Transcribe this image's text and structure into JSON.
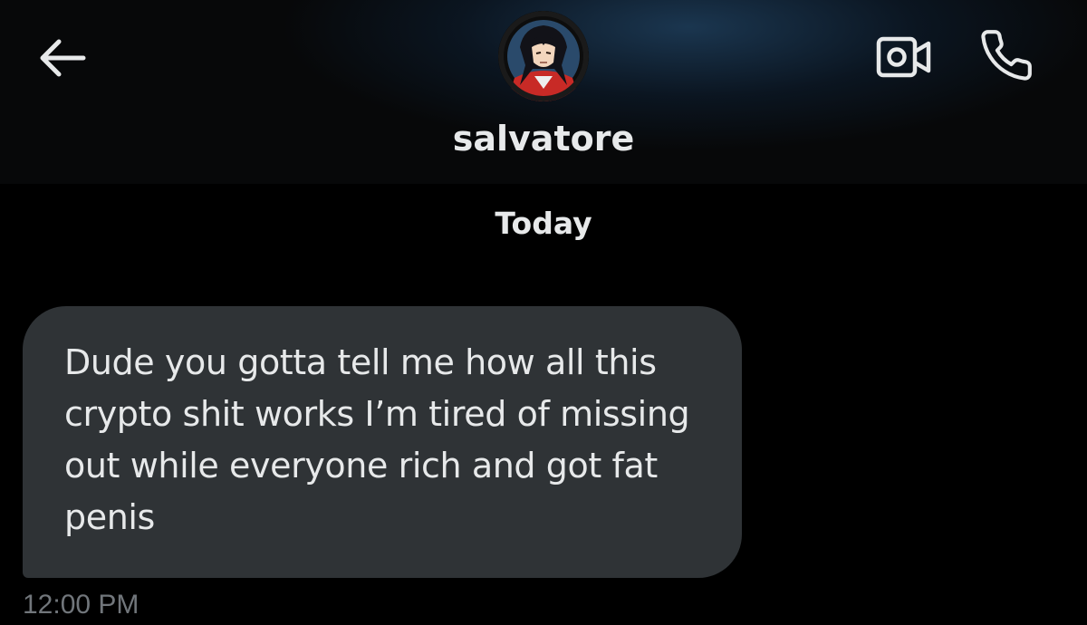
{
  "header": {
    "contact_name": "salvatore",
    "icons": {
      "back": "arrow-left-icon",
      "video": "video-camera-icon",
      "call": "phone-icon"
    },
    "avatar": "avatar-anime-character"
  },
  "conversation": {
    "date_separator": "Today",
    "messages": [
      {
        "text": "Dude you gotta tell me how all this crypto shit works I’m tired of missing out while everyone rich and got fat penis",
        "time": "12:00 PM"
      }
    ]
  },
  "colors": {
    "background": "#000000",
    "bubble": "#2f3336",
    "text": "#e7e9ea",
    "secondary_text": "#71767b"
  }
}
